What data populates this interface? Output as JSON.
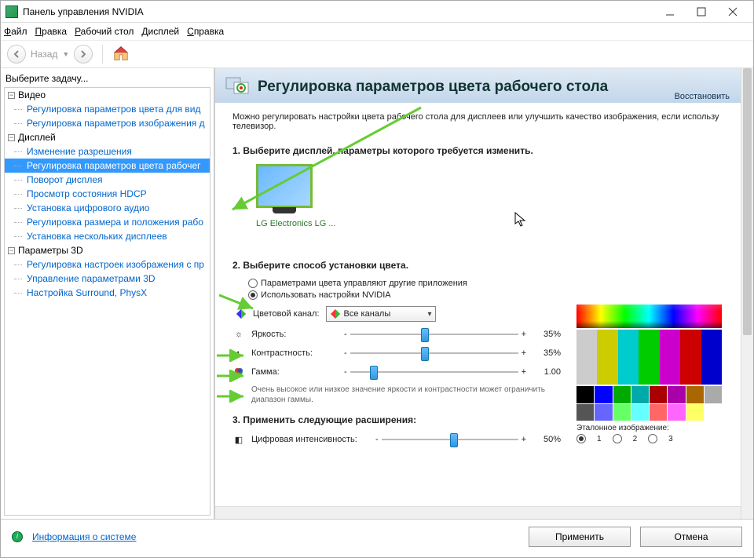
{
  "window": {
    "title": "Панель управления NVIDIA"
  },
  "menu": {
    "file": "Файл",
    "edit": "Правка",
    "desktop": "Рабочий стол",
    "display": "Дисплей",
    "help": "Справка"
  },
  "toolbar": {
    "back": "Назад"
  },
  "sidebar": {
    "title": "Выберите задачу...",
    "cats": {
      "video": "Видео",
      "display": "Дисплей",
      "p3d": "Параметры 3D"
    },
    "items": {
      "v1": "Регулировка параметров цвета для вид",
      "v2": "Регулировка параметров изображения д",
      "d1": "Изменение разрешения",
      "d2": "Регулировка параметров цвета рабочег",
      "d3": "Поворот дисплея",
      "d4": "Просмотр состояния HDCP",
      "d5": "Установка цифрового аудио",
      "d6": "Регулировка размера и положения рабо",
      "d7": "Установка нескольких дисплеев",
      "p1": "Регулировка настроек изображения с пр",
      "p2": "Управление параметрами 3D",
      "p3": "Настройка Surround, PhysX"
    }
  },
  "page": {
    "title": "Регулировка параметров цвета рабочего стола",
    "restore": "Восстановить",
    "desc": "Можно регулировать настройки цвета рабочего стола для дисплеев или улучшить качество изображения, если использу телевизор.",
    "step1": "1. Выберите дисплей, параметры которого требуется изменить.",
    "monitor": "LG Electronics LG ...",
    "step2": "2. Выберите способ установки цвета.",
    "radio1": "Параметрами цвета управляют другие приложения",
    "radio2": "Использовать настройки NVIDIA",
    "channel_label": "Цветовой канал:",
    "channel_value": "Все каналы",
    "brightness": "Яркость:",
    "contrast": "Контрастность:",
    "gamma": "Гамма:",
    "v_brightness": "35%",
    "v_contrast": "35%",
    "v_gamma": "1.00",
    "note": "Очень высокое или низкое значение яркости и контрастности может ограничить диапазон гаммы.",
    "step3": "3. Применить следующие расширения:",
    "digital_intensity": "Цифровая интенсивность:",
    "v_digital": "50%",
    "ref_label": "Эталонное изображение:",
    "ref1": "1",
    "ref2": "2",
    "ref3": "3"
  },
  "footer": {
    "system_info": "Информация о системе",
    "apply": "Применить",
    "cancel": "Отмена"
  }
}
